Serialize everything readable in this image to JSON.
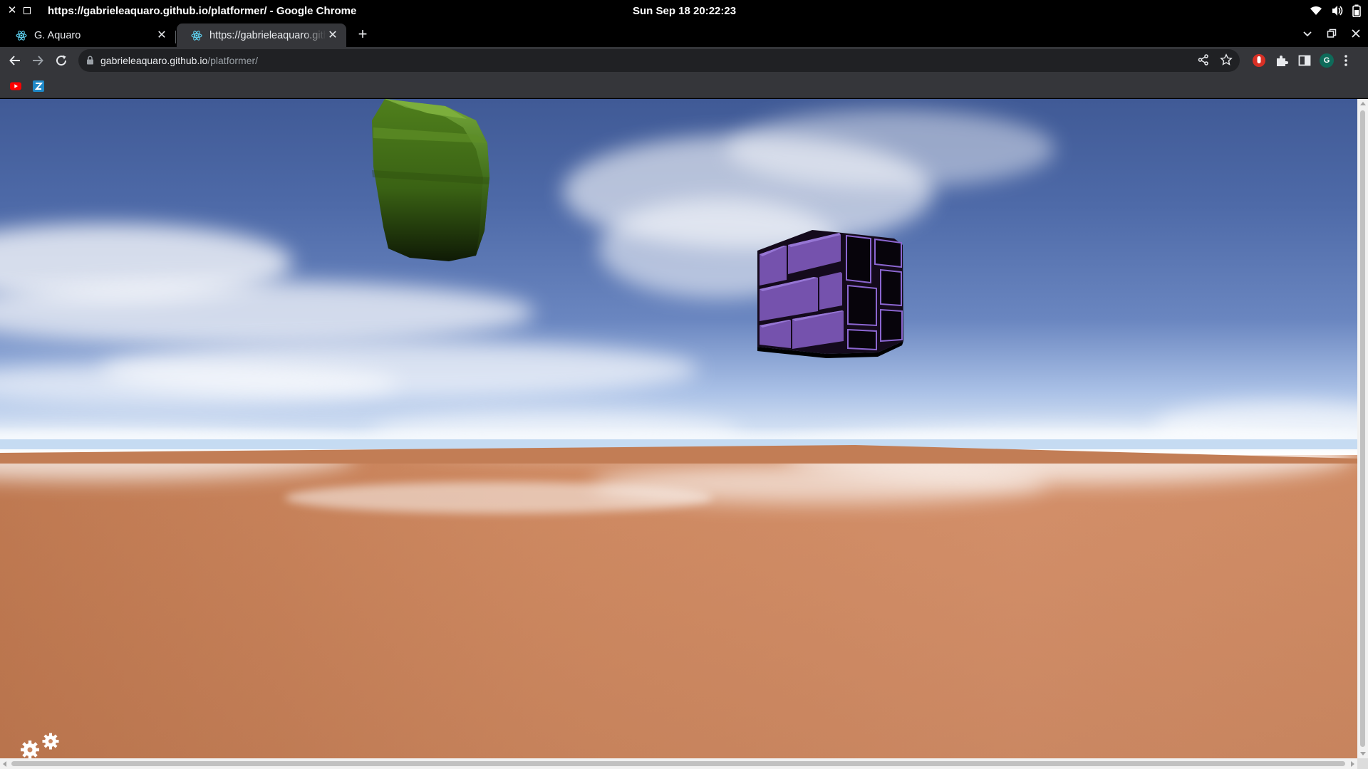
{
  "system_bar": {
    "window_title": "https://gabrieleaquaro.github.io/platformer/ - Google Chrome",
    "clock": "Sun Sep 18  20:22:23",
    "tray_icons": [
      "wifi-icon",
      "volume-icon",
      "battery-icon"
    ]
  },
  "tabs": [
    {
      "title": "G. Aquaro",
      "favicon": "react-atom-icon",
      "active": false
    },
    {
      "title": "https://gabrieleaquaro.github.io/platformer/",
      "favicon": "react-atom-icon",
      "active": true
    }
  ],
  "toolbar": {
    "url_host": "gabrieleaquaro.github.io",
    "url_path": "/platformer/"
  },
  "bookmarks": [
    {
      "name": "youtube-bookmark",
      "icon": "youtube-icon"
    },
    {
      "name": "app-bookmark",
      "icon": "blue-square-app-icon"
    }
  ],
  "scene": {
    "objects": [
      "green-rounded-block",
      "purple-brick-cube"
    ],
    "sky_color": "#4e6aa8",
    "ground_color": "#d08c65",
    "settings_icon": "settings-gears-icon"
  }
}
